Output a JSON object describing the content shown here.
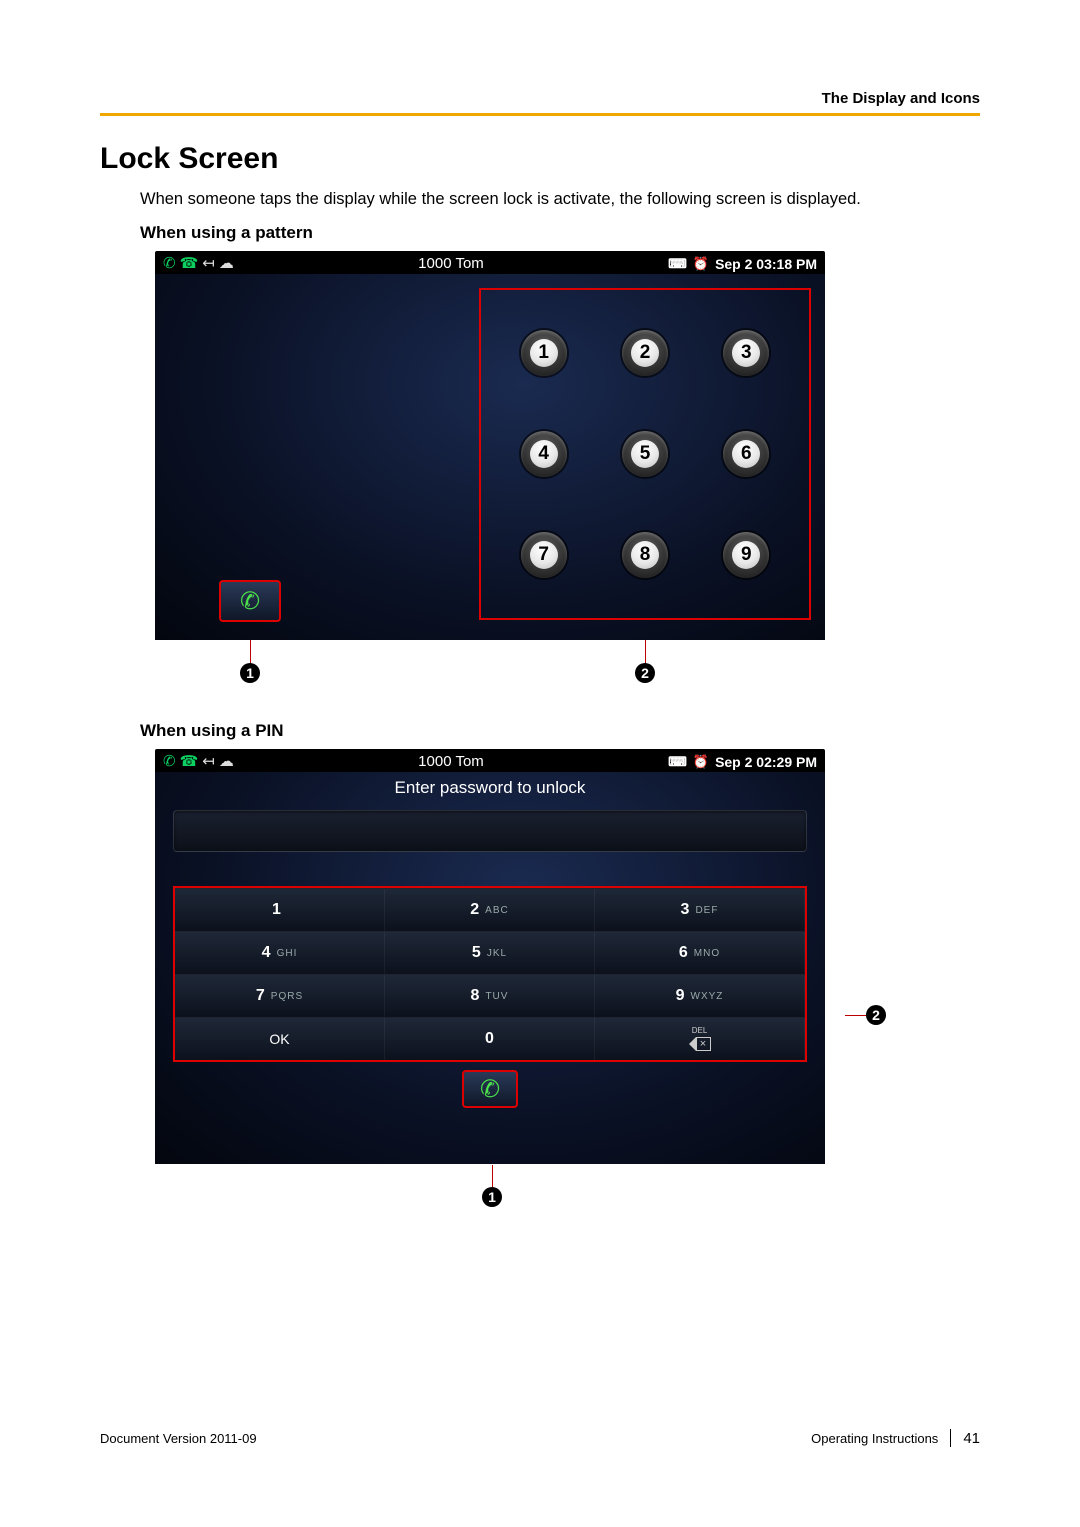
{
  "header": {
    "section": "The Display and Icons"
  },
  "title": "Lock Screen",
  "intro": "When someone taps the display while the screen lock is activate, the following screen is displayed.",
  "patternHeading": "When using a pattern",
  "pinHeading": "When using a PIN",
  "patternScreen": {
    "statusCenter": "1000  Tom",
    "statusTime": "Sep 2 03:18 PM",
    "dots": [
      "1",
      "2",
      "3",
      "4",
      "5",
      "6",
      "7",
      "8",
      "9"
    ]
  },
  "callouts": {
    "one": "1",
    "two": "2"
  },
  "pinScreen": {
    "statusCenter": "1000  Tom",
    "statusTime": "Sep 2 02:29 PM",
    "prompt": "Enter password to unlock",
    "keys": [
      {
        "d": "1",
        "l": ""
      },
      {
        "d": "2",
        "l": "ABC"
      },
      {
        "d": "3",
        "l": "DEF"
      },
      {
        "d": "4",
        "l": "GHI"
      },
      {
        "d": "5",
        "l": "JKL"
      },
      {
        "d": "6",
        "l": "MNO"
      },
      {
        "d": "7",
        "l": "PQRS"
      },
      {
        "d": "8",
        "l": "TUV"
      },
      {
        "d": "9",
        "l": "WXYZ"
      }
    ],
    "ok": "OK",
    "zero": "0",
    "delLabel": "DEL"
  },
  "footer": {
    "left": "Document Version  2011-09",
    "rightText": "Operating Instructions",
    "page": "41"
  }
}
